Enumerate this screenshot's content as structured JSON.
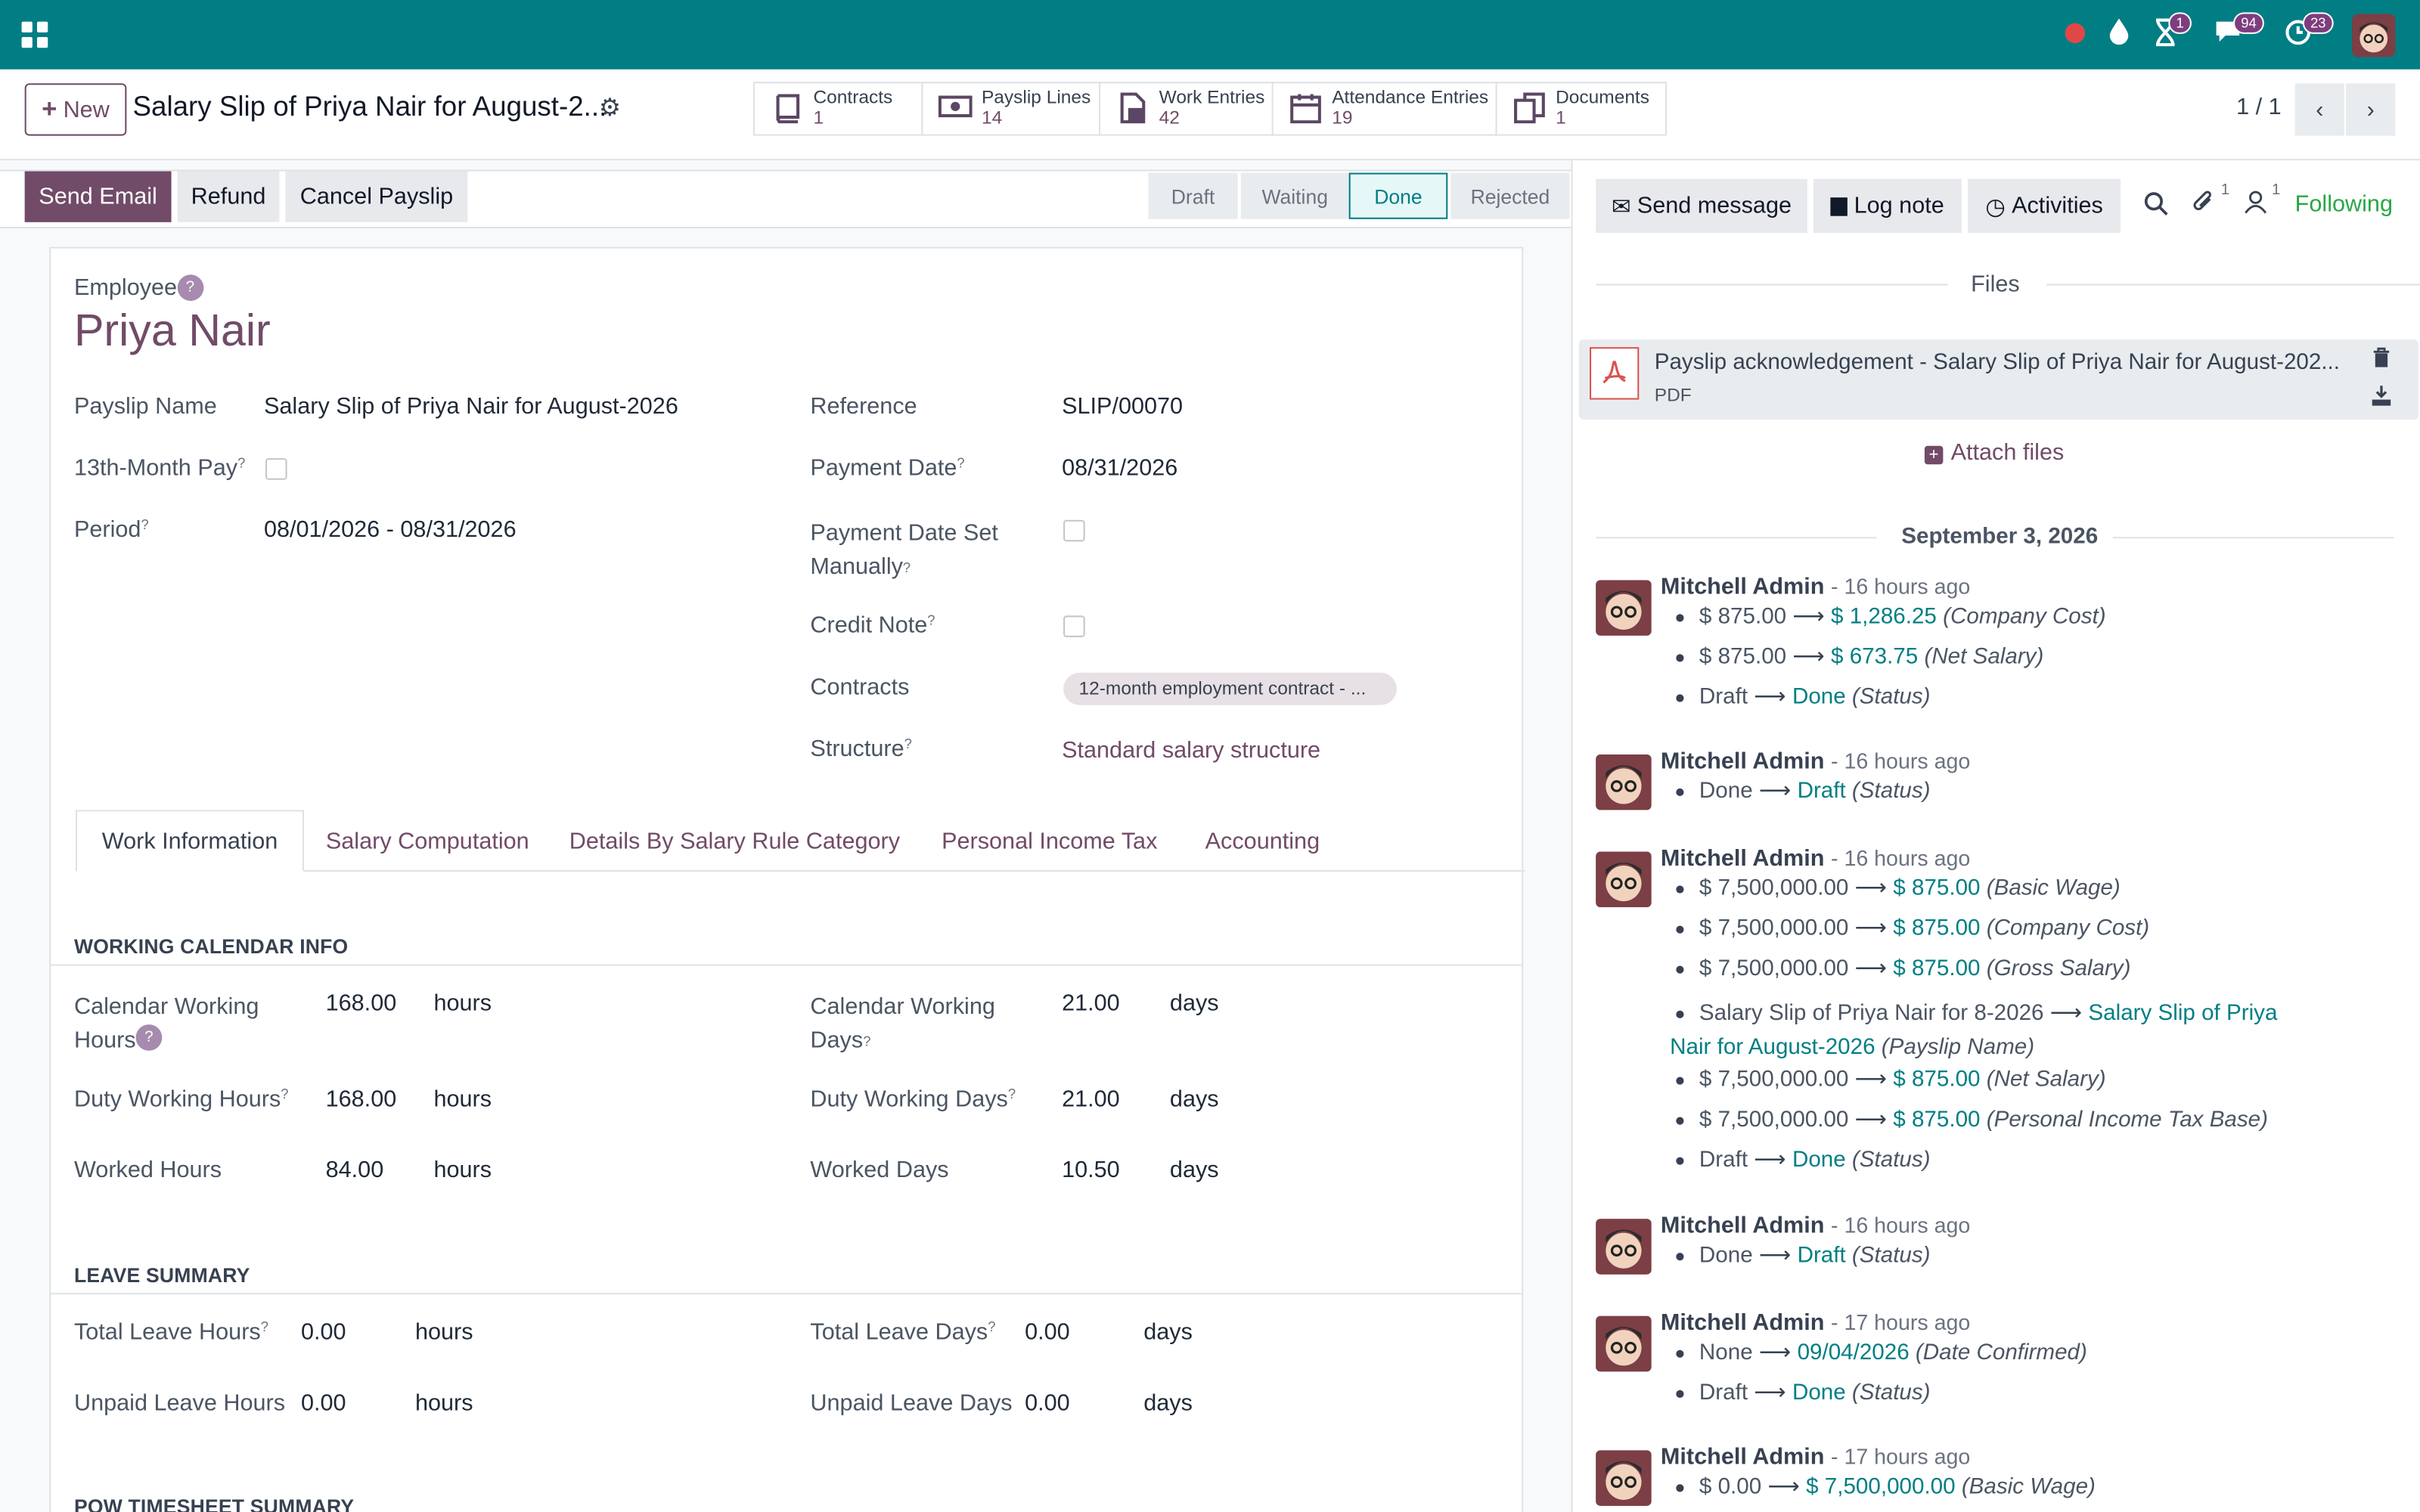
{
  "topbar": {
    "badges": {
      "activity": "1",
      "messages": "94",
      "clock": "23"
    }
  },
  "control": {
    "new_label": "New",
    "title": "Salary Slip of Priya Nair for August-2...",
    "smart_buttons": [
      {
        "label": "Contracts",
        "value": "1"
      },
      {
        "label": "Payslip Lines",
        "value": "14"
      },
      {
        "label": "Work Entries",
        "value": "42"
      },
      {
        "label": "Attendance Entries",
        "value": "19"
      },
      {
        "label": "Documents",
        "value": "1"
      }
    ],
    "pager": "1 / 1"
  },
  "actions": {
    "send_email": "Send Email",
    "refund": "Refund",
    "cancel": "Cancel Payslip"
  },
  "statusbar": [
    "Draft",
    "Waiting",
    "Done",
    "Rejected"
  ],
  "form": {
    "employee_label": "Employee",
    "employee_help": "?",
    "employee_name": "Priya Nair",
    "payslip_name_label": "Payslip Name",
    "payslip_name": "Salary Slip of Priya Nair for August-2026",
    "thirteenth_label": "13th-Month Pay",
    "period_label": "Period",
    "period": "08/01/2026 - 08/31/2026",
    "reference_label": "Reference",
    "reference": "SLIP/00070",
    "payment_date_label": "Payment Date",
    "payment_date": "08/31/2026",
    "payment_manual_label_1": "Payment Date Set",
    "payment_manual_label_2": "Manually",
    "credit_note_label": "Credit Note",
    "contracts_label": "Contracts",
    "contract_tag": "12-month employment contract - ...",
    "structure_label": "Structure",
    "structure": "Standard salary structure",
    "sup": "?"
  },
  "tabs": [
    "Work Information",
    "Salary Computation",
    "Details By Salary Rule Category",
    "Personal Income Tax",
    "Accounting"
  ],
  "work": {
    "calendar_info_title": "WORKING CALENDAR INFO",
    "cal_hours_label_1": "Calendar Working",
    "cal_hours_label_2": "Hours",
    "cal_hours": "168.00",
    "cal_days_label_1": "Calendar Working",
    "cal_days_label_2": "Days",
    "cal_days": "21.00",
    "duty_hours_label": "Duty Working Hours",
    "duty_hours": "168.00",
    "duty_days_label": "Duty Working Days",
    "duty_days": "21.00",
    "worked_hours_label": "Worked Hours",
    "worked_hours": "84.00",
    "worked_days_label": "Worked Days",
    "worked_days": "10.50",
    "hours_unit": "hours",
    "days_unit": "days",
    "leave_title": "LEAVE SUMMARY",
    "total_leave_hours_label": "Total Leave Hours",
    "total_leave_hours": "0.00",
    "total_leave_days_label": "Total Leave Days",
    "total_leave_days": "0.00",
    "unpaid_leave_hours_label": "Unpaid Leave Hours",
    "unpaid_leave_hours": "0.00",
    "unpaid_leave_days_label": "Unpaid Leave Days",
    "unpaid_leave_days": "0.00",
    "timesheet_title": "POW TIMESHEET SUMMARY"
  },
  "chatter": {
    "send_message": "Send message",
    "log_note": "Log note",
    "activities": "Activities",
    "attach_count": "1",
    "follower_count": "1",
    "following": "Following",
    "files_title": "Files",
    "file_name": "Payslip acknowledgement - Salary Slip of Priya Nair for August-202...",
    "file_type": "PDF",
    "attach_files": "Attach files",
    "date_sep": "September 3, 2026",
    "messages": [
      {
        "author": "Mitchell Admin",
        "ago": "- 16 hours ago",
        "changes": [
          {
            "old": "$ 875.00",
            "new": "$ 1,286.25",
            "field": "(Company Cost)"
          },
          {
            "old": "$ 875.00",
            "new": "$ 673.75",
            "field": "(Net Salary)"
          },
          {
            "old": "Draft",
            "new": "Done",
            "field": "(Status)"
          }
        ]
      },
      {
        "author": "Mitchell Admin",
        "ago": "- 16 hours ago",
        "changes": [
          {
            "old": "Done",
            "new": "Draft",
            "field": "(Status)"
          }
        ]
      },
      {
        "author": "Mitchell Admin",
        "ago": "- 16 hours ago",
        "changes": [
          {
            "old": "$ 7,500,000.00",
            "new": "$ 875.00",
            "field": "(Basic Wage)"
          },
          {
            "old": "$ 7,500,000.00",
            "new": "$ 875.00",
            "field": "(Company Cost)"
          },
          {
            "old": "$ 7,500,000.00",
            "new": "$ 875.00",
            "field": "(Gross Salary)"
          },
          {
            "old": "Salary Slip of Priya Nair for 8-2026",
            "new": "Salary Slip of Priya",
            "new2": "Nair for August-2026",
            "field": "(Payslip Name)"
          },
          {
            "old": "$ 7,500,000.00",
            "new": "$ 875.00",
            "field": "(Net Salary)"
          },
          {
            "old": "$ 7,500,000.00",
            "new": "$ 875.00",
            "field": "(Personal Income Tax Base)"
          },
          {
            "old": "Draft",
            "new": "Done",
            "field": "(Status)"
          }
        ]
      },
      {
        "author": "Mitchell Admin",
        "ago": "- 16 hours ago",
        "changes": [
          {
            "old": "Done",
            "new": "Draft",
            "field": "(Status)"
          }
        ]
      },
      {
        "author": "Mitchell Admin",
        "ago": "- 17 hours ago",
        "changes": [
          {
            "old": "None",
            "new": "09/04/2026",
            "field": "(Date Confirmed)"
          },
          {
            "old": "Draft",
            "new": "Done",
            "field": "(Status)"
          }
        ]
      },
      {
        "author": "Mitchell Admin",
        "ago": "- 17 hours ago",
        "changes": [
          {
            "old": "$ 0.00",
            "new": "$ 7,500,000.00",
            "field": "(Basic Wage)"
          }
        ]
      }
    ]
  },
  "colors": {
    "brand": "#017e84",
    "primary": "#714b67",
    "link": "#017e84"
  }
}
